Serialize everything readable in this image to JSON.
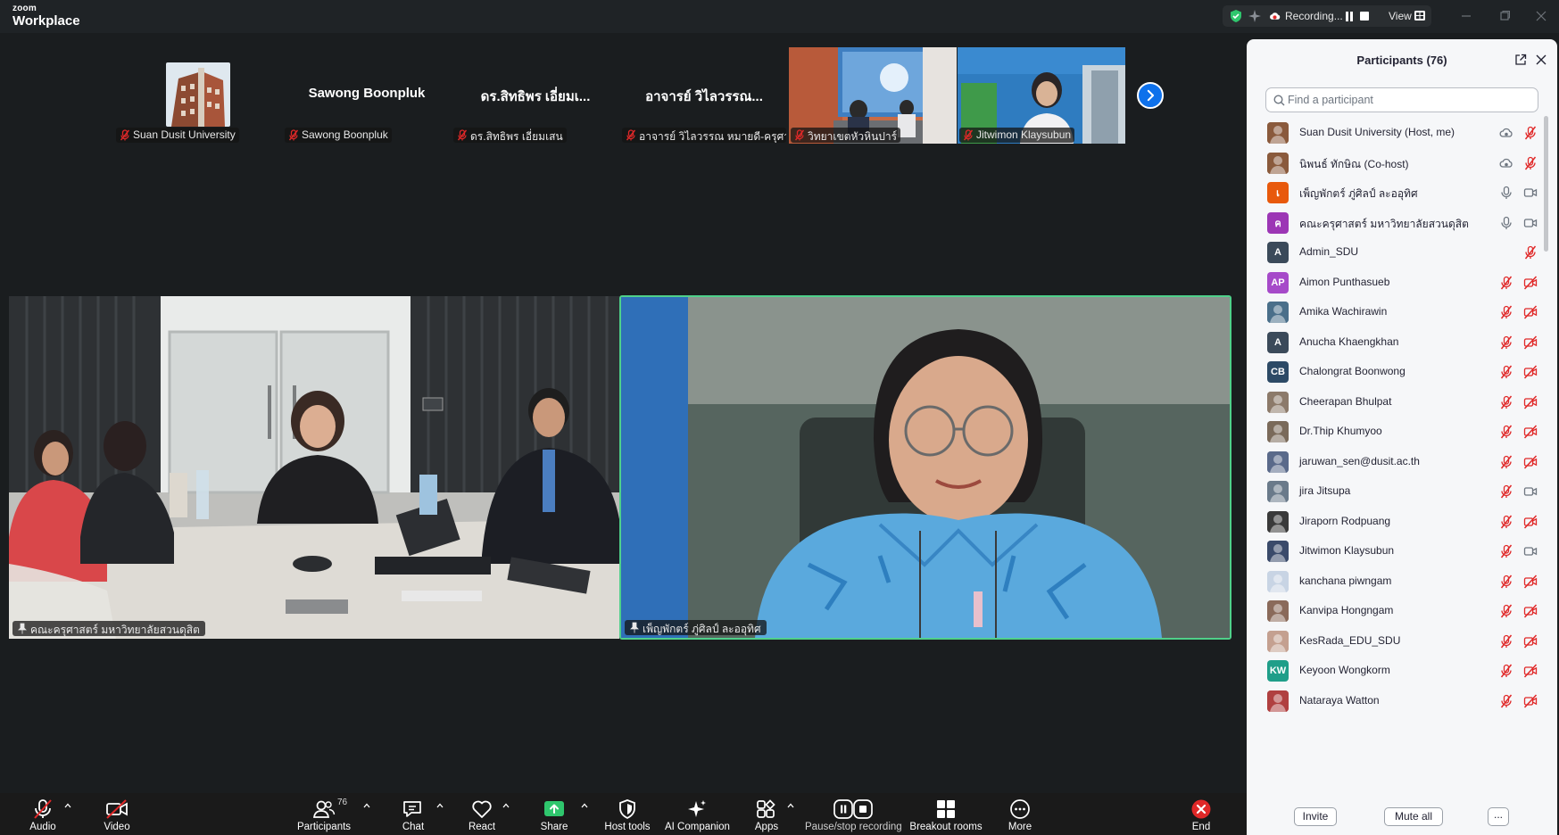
{
  "app": {
    "brand_top": "zoom",
    "brand_bottom": "Workplace"
  },
  "recording": {
    "status": "Recording...",
    "view_label": "View"
  },
  "filmstrip": [
    {
      "display": "",
      "tag": "Suan Dusit University",
      "kind": "photo"
    },
    {
      "display": "Sawong Boonpluk",
      "tag": "Sawong Boonpluk",
      "kind": "name"
    },
    {
      "display": "ดร.สิทธิพร เอี่ยมเ...",
      "tag": "ดร.สิทธิพร เอี่ยมเสน",
      "kind": "name"
    },
    {
      "display": "อาจารย์ วิไลวรรณ...",
      "tag": "อาจารย์ วิไลวรรณ หมายดี-ครุศาส...",
      "kind": "name"
    },
    {
      "display": "",
      "tag": "วิทยาเขตหัวหินปาร์",
      "kind": "video"
    },
    {
      "display": "",
      "tag": "Jitwimon Klaysubun",
      "kind": "video"
    }
  ],
  "main_video": {
    "left_tag": "คณะครุศาสตร์ มหาวิทยาลัยสวนดุสิต",
    "right_tag": "เพ็ญพักตร์ ภู่ศิลป์ ละออุทิศ"
  },
  "panel": {
    "title": "Participants (76)",
    "search_placeholder": "Find a participant",
    "invite": "Invite",
    "mute_all": "Mute all",
    "more": "..."
  },
  "participants": [
    {
      "name": "Suan Dusit University (Host, me)",
      "avatar": "",
      "color": "#8a5a3c",
      "a": "cloud",
      "b": "mic-off-red"
    },
    {
      "name": "นิพนธ์ ทักษิณ (Co-host)",
      "avatar": "",
      "color": "#8a5a3c",
      "a": "cloud",
      "b": "mic-off-red"
    },
    {
      "name": "เพ็ญพักตร์ ภู่ศิลป์ ละออุทิศ",
      "avatar": "เ",
      "color": "#e8590c",
      "a": "mic",
      "b": "video"
    },
    {
      "name": "คณะครุศาสตร์ มหาวิทยาลัยสวนดุสิต",
      "avatar": "ค",
      "color": "#9c36b5",
      "a": "mic",
      "b": "video"
    },
    {
      "name": "Admin_SDU",
      "avatar": "A",
      "color": "#3b4a5a",
      "a": "",
      "b": "mic-off-red"
    },
    {
      "name": "Aimon Punthasueb",
      "avatar": "AP",
      "color": "#a64ac9",
      "a": "mic-off-red",
      "b": "video-off-red"
    },
    {
      "name": "Amika Wachirawin",
      "avatar": "",
      "color": "#4a6f8a",
      "a": "mic-off-red",
      "b": "video-off-red"
    },
    {
      "name": "Anucha Khaengkhan",
      "avatar": "A",
      "color": "#3b4a5a",
      "a": "mic-off-red",
      "b": "video-off-red"
    },
    {
      "name": "Chalongrat Boonwong",
      "avatar": "CB",
      "color": "#2d4a66",
      "a": "mic-off-red",
      "b": "video-off-red"
    },
    {
      "name": "Cheerapan Bhulpat",
      "avatar": "",
      "color": "#8c7a6a",
      "a": "mic-off-red",
      "b": "video-off-red"
    },
    {
      "name": "Dr.Thip Khumyoo",
      "avatar": "",
      "color": "#7a6a5a",
      "a": "mic-off-red",
      "b": "video-off-red"
    },
    {
      "name": "jaruwan_sen@dusit.ac.th",
      "avatar": "",
      "color": "#5a6a8a",
      "a": "mic-off-red",
      "b": "video-off-red"
    },
    {
      "name": "jira Jitsupa",
      "avatar": "",
      "color": "#6a7a8a",
      "a": "mic-off-red",
      "b": "video"
    },
    {
      "name": "Jiraporn Rodpuang",
      "avatar": "",
      "color": "#3a3a3a",
      "a": "mic-off-red",
      "b": "video-off-red"
    },
    {
      "name": "Jitwimon Klaysubun",
      "avatar": "",
      "color": "#3a4a6a",
      "a": "mic-off-red",
      "b": "video"
    },
    {
      "name": "kanchana piwngam",
      "avatar": "",
      "color": "#c8d4e4",
      "a": "mic-off-red",
      "b": "video-off-red"
    },
    {
      "name": "Kanvipa Hongngam",
      "avatar": "",
      "color": "#8a6a5a",
      "a": "mic-off-red",
      "b": "video-off-red"
    },
    {
      "name": "KesRada_EDU_SDU",
      "avatar": "",
      "color": "#c4a090",
      "a": "mic-off-red",
      "b": "video-off-red"
    },
    {
      "name": "Keyoon Wongkorm",
      "avatar": "KW",
      "color": "#1f9e89",
      "a": "mic-off-red",
      "b": "video-off-red"
    },
    {
      "name": "Nataraya Watton",
      "avatar": "",
      "color": "#b04040",
      "a": "mic-off-red",
      "b": "video-off-red"
    }
  ],
  "toolbar": {
    "audio": "Audio",
    "video": "Video",
    "participants": "Participants",
    "participant_count": "76",
    "chat": "Chat",
    "react": "React",
    "share": "Share",
    "host_tools": "Host tools",
    "ai_companion": "AI Companion",
    "apps": "Apps",
    "pause_stop": "Pause/stop recording",
    "breakout": "Breakout rooms",
    "more": "More",
    "end": "End"
  },
  "colors": {
    "accent": "#0e71eb",
    "share": "#2fc66d",
    "danger": "#e02828",
    "active_speaker": "#4fd08a"
  }
}
